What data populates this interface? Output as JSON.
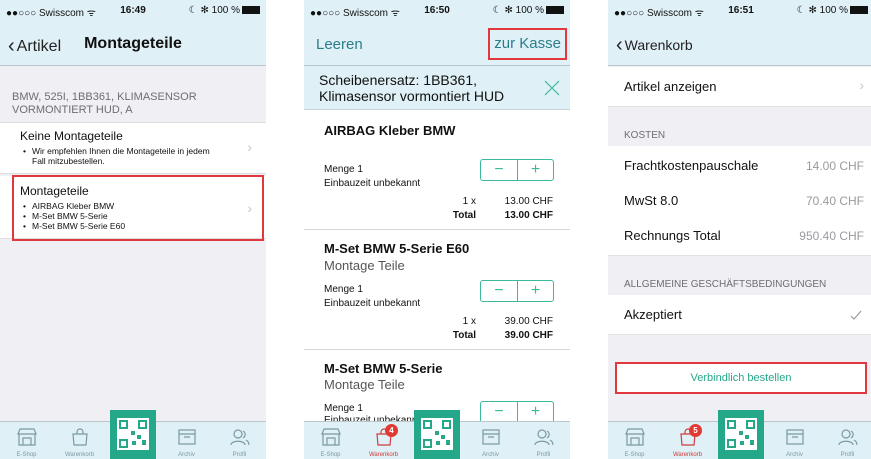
{
  "colors": {
    "accent": "#25a88a",
    "highlight": "#e2373c",
    "bar": "#dff0f6",
    "link": "#2b7d8a"
  },
  "statusbar": {
    "carrier": "●●○○○ Swisscom ᯤ",
    "battery": "☾ ✻ 100 %",
    "time1": "16:49",
    "time2": "16:50",
    "time3": "16:51"
  },
  "tabs": {
    "eshop": "E-Shop",
    "cart": "Warenkorb",
    "archive": "Archiv",
    "profile": "Profil"
  },
  "screen1": {
    "back_label": "Artikel",
    "title": "Montageteile",
    "header": "BMW, 525I, 1BB361, KLIMASENSOR VORMONTIERT  HUD, A",
    "option1": {
      "title": "Keine Montageteile",
      "bullets": [
        "Wir empfehlen Ihnen die Montageteile in jedem Fall mitzubestellen."
      ]
    },
    "option2": {
      "title": "Montageteile",
      "bullets": [
        "AIRBAG Kleber BMW",
        "M-Set BMW 5-Serie",
        "M-Set BMW 5-Serie E60"
      ]
    }
  },
  "screen2": {
    "left_button": "Leeren",
    "right_button": "zur Kasse",
    "header": "Scheibenersatz: 1BB361, Klimasensor vormontiert  HUD",
    "items": [
      {
        "title": "AIRBAG Kleber BMW",
        "subtitle": "",
        "qty_label": "Menge 1",
        "time": "Einbauzeit unbekannt",
        "qty": "1 x",
        "unit_price": "13.00 CHF",
        "total_label": "Total",
        "total": "13.00 CHF"
      },
      {
        "title": "M-Set BMW 5-Serie E60",
        "subtitle": "Montage Teile",
        "qty_label": "Menge 1",
        "time": "Einbauzeit unbekannt",
        "qty": "1 x",
        "unit_price": "39.00 CHF",
        "total_label": "Total",
        "total": "39.00 CHF"
      },
      {
        "title": "M-Set BMW 5-Serie",
        "subtitle": "Montage Teile",
        "qty_label": "Menge 1",
        "time": "Einbauzeit unbekannt"
      }
    ],
    "cart_badge": "4"
  },
  "screen3": {
    "back_label": "Warenkorb",
    "show_items": "Artikel anzeigen",
    "costs_header": "KOSTEN",
    "costs": [
      {
        "label": "Frachtkostenpauschale",
        "value": "14.00 CHF"
      },
      {
        "label": "MwSt 8.0",
        "value": "70.40 CHF"
      },
      {
        "label": "Rechnungs Total",
        "value": "950.40 CHF"
      }
    ],
    "terms_header": "ALLGEMEINE GESCHÄFTSBEDINGUNGEN",
    "accepted": "Akzeptiert",
    "order_button": "Verbindlich bestellen",
    "cart_badge": "5"
  }
}
